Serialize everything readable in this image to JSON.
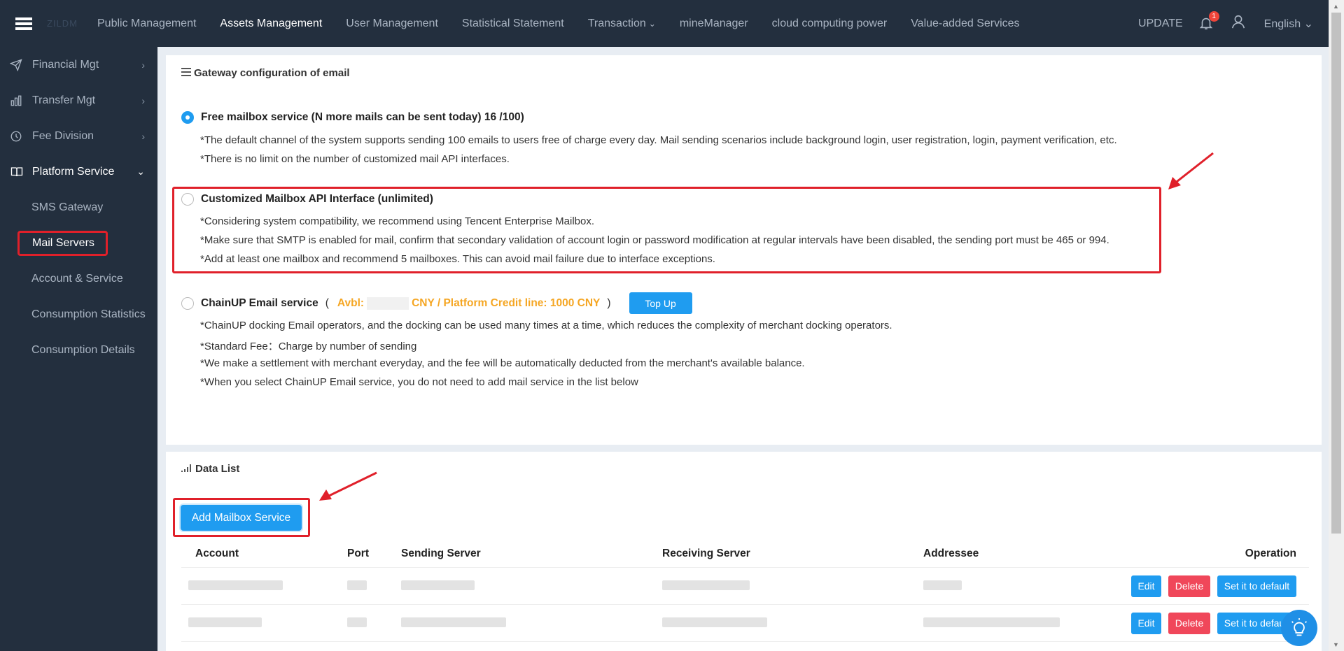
{
  "topbar": {
    "logo_text": "ZILDM",
    "nav": [
      {
        "label": "Public Management",
        "active": false
      },
      {
        "label": "Assets Management",
        "active": true
      },
      {
        "label": "User Management",
        "active": false
      },
      {
        "label": "Statistical Statement",
        "active": false
      },
      {
        "label": "Transaction",
        "active": false
      },
      {
        "label": "mineManager",
        "active": false
      },
      {
        "label": "cloud computing power",
        "active": false
      },
      {
        "label": "Value-added Services",
        "active": false
      }
    ],
    "update_label": "UPDATE",
    "notification_count": "1",
    "language": "English"
  },
  "sidebar": {
    "items": [
      {
        "label": "Financial Mgt",
        "icon": "send-icon"
      },
      {
        "label": "Transfer Mgt",
        "icon": "bar-chart-icon"
      },
      {
        "label": "Fee Division",
        "icon": "clock-icon"
      },
      {
        "label": "Platform Service",
        "icon": "book-icon"
      }
    ],
    "sub_items": [
      {
        "label": "SMS Gateway"
      },
      {
        "label": "Mail Servers"
      },
      {
        "label": "Account & Service"
      },
      {
        "label": "Consumption Statistics"
      },
      {
        "label": "Consumption Details"
      }
    ]
  },
  "gateway": {
    "title": "Gateway configuration of email",
    "option1": {
      "title": "Free mailbox service (N more mails can be sent today) 16 /100)",
      "lines": [
        "*The default channel of the system supports sending 100 emails to users free of charge every day. Mail sending scenarios include background login, user registration, login, payment verification, etc.",
        "*There is no limit on the number of customized mail API interfaces."
      ]
    },
    "option2": {
      "title": "Customized Mailbox API Interface (unlimited)",
      "lines": [
        "*Considering system compatibility, we recommend using Tencent Enterprise Mailbox.",
        "*Make sure that SMTP is enabled for mail, confirm that secondary validation of account login or password modification at regular intervals have been disabled, the sending port must be 465 or 994.",
        "*Add at least one mailbox and recommend 5 mailboxes. This can avoid mail failure due to interface exceptions."
      ]
    },
    "option3": {
      "title": "ChainUP Email service",
      "paren_open": "(",
      "avbl_label": "Avbl:",
      "credit_text": "CNY / Platform Credit line: 1000 CNY",
      "paren_close": ")",
      "topup_label": "Top Up",
      "lines": [
        "*ChainUP docking Email operators, and the docking can be used many times at a time, which reduces the complexity of merchant docking operators.",
        "*Standard Fee：Charge by number of sending",
        "*We make a settlement with merchant everyday, and the fee will be automatically deducted from the merchant's available balance.",
        "*When you select ChainUP Email service, you do not need to add mail service in the list below"
      ]
    }
  },
  "datalist": {
    "title": "Data List",
    "add_button": "Add Mailbox Service",
    "columns": [
      "Account",
      "Port",
      "Sending Server",
      "Receiving Server",
      "Addressee",
      "Operation"
    ],
    "actions": {
      "edit": "Edit",
      "delete": "Delete",
      "default": "Set it to default"
    }
  },
  "colors": {
    "sidebar_bg": "#232f3e",
    "accent": "#1f9cf0",
    "danger": "#f0475a",
    "highlight": "#e0202a",
    "credit": "#f5a623"
  }
}
